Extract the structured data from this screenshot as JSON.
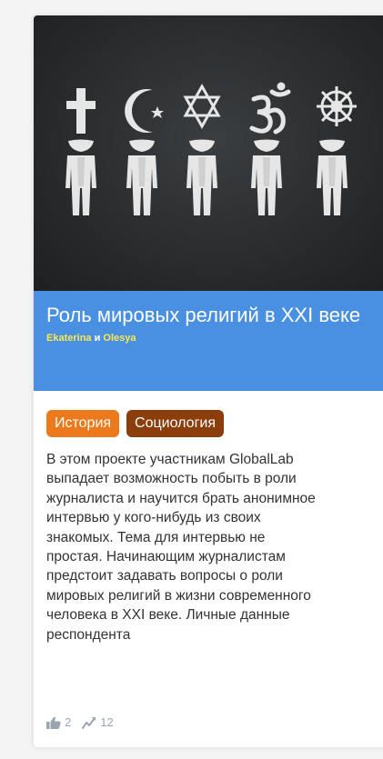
{
  "project": {
    "title": "Роль мировых религий в XXI веке",
    "authors": {
      "first": "Ekaterina",
      "conjunction": "и",
      "second": "Olesya"
    },
    "tags": [
      "История",
      "Социология"
    ],
    "description": "В этом проекте участникам GlobalLab выпадает возможность побыть в роли журналиста и научится брать анонимное интервью у кого-нибудь из своих знакомых. Тема для интервью не простая. Начинающим журналистам предстоит задавать вопросы о роли мировых религий в жизни современного человека в XXI веке. Личные данные респондента",
    "stats": {
      "likes": "2",
      "views": "12"
    }
  },
  "cover": {
    "symbols": [
      "cross-icon",
      "crescent-star-icon",
      "star-of-david-icon",
      "om-icon",
      "dharma-wheel-icon"
    ]
  },
  "colors": {
    "title_band": "#4a90e2",
    "tag_history": "#ec7a1c",
    "tag_sociology": "#8b3e0c",
    "author_link": "#fde94a"
  }
}
